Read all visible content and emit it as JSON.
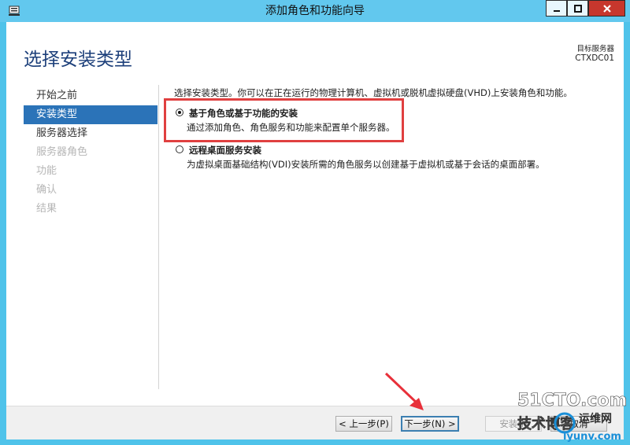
{
  "window": {
    "title": "添加角色和功能向导"
  },
  "header": {
    "page_title": "选择安装类型",
    "server_label": "目标服务器",
    "server_name": "CTXDC01"
  },
  "nav": {
    "items": [
      {
        "label": "开始之前",
        "state": "normal"
      },
      {
        "label": "安装类型",
        "state": "active"
      },
      {
        "label": "服务器选择",
        "state": "normal"
      },
      {
        "label": "服务器角色",
        "state": "disabled"
      },
      {
        "label": "功能",
        "state": "disabled"
      },
      {
        "label": "确认",
        "state": "disabled"
      },
      {
        "label": "结果",
        "state": "disabled"
      }
    ]
  },
  "content": {
    "instruction": "选择安装类型。你可以在正在运行的物理计算机、虚拟机或脱机虚拟硬盘(VHD)上安装角色和功能。",
    "options": [
      {
        "title": "基于角色或基于功能的安装",
        "description": "通过添加角色、角色服务和功能来配置单个服务器。",
        "selected": true
      },
      {
        "title": "远程桌面服务安装",
        "description": "为虚拟桌面基础结构(VDI)安装所需的角色服务以创建基于虚拟机或基于会话的桌面部署。",
        "selected": false
      }
    ]
  },
  "buttons": {
    "prev": "< 上一步(P)",
    "next": "下一步(N) >",
    "install": "安装(I)",
    "cancel": "取消"
  },
  "watermark": {
    "line1": "51CTO.com",
    "line2": "技术博客",
    "line3": "运维网",
    "line4": "iyunv.com"
  },
  "colors": {
    "title_bar": "#62c8ee",
    "accent": "#2b73b8",
    "close_button": "#c7372d",
    "highlight": "#e04040"
  }
}
